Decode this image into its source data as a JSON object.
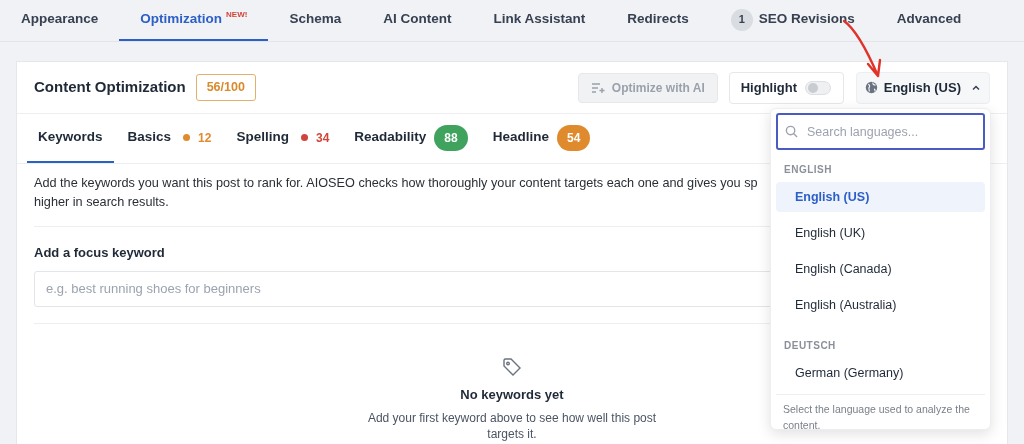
{
  "top_tabs": [
    {
      "label": "Appearance",
      "selected": false
    },
    {
      "label": "Optimization",
      "badge": "NEW!",
      "selected": true
    },
    {
      "label": "Schema",
      "selected": false
    },
    {
      "label": "AI Content",
      "selected": false
    },
    {
      "label": "Link Assistant",
      "selected": false
    },
    {
      "label": "Redirects",
      "selected": false
    },
    {
      "label": "SEO Revisions",
      "count": "1",
      "selected": false
    },
    {
      "label": "Advanced",
      "selected": false
    }
  ],
  "panel": {
    "title": "Content Optimization",
    "score": "56/100",
    "optimize_button": {
      "label": "Optimize with AI",
      "disabled": true
    },
    "highlight": {
      "label": "Highlight",
      "on": false
    },
    "language_button": {
      "label": "English (US)",
      "expanded": true
    }
  },
  "sub_tabs": [
    {
      "label": "Keywords",
      "selected": true
    },
    {
      "label": "Basics",
      "kind": "dot",
      "value": "12",
      "color": "#e08a2e",
      "selected": false
    },
    {
      "label": "Spelling",
      "kind": "dot",
      "value": "34",
      "color": "#d0443a",
      "selected": false
    },
    {
      "label": "Readability",
      "kind": "pill",
      "value": "88",
      "color": "#3fa35e",
      "selected": false
    },
    {
      "label": "Headline",
      "kind": "pill",
      "value": "54",
      "color": "#e08a2e",
      "selected": false
    }
  ],
  "description_lines": [
    "Add the keywords you want this post to rank for. AIOSEO checks how thoroughly your content targets each one and gives you sp",
    "higher in search results."
  ],
  "focus_keyword": {
    "label": "Add a focus keyword",
    "placeholder": "e.g. best running shoes for beginners"
  },
  "empty_state": {
    "title": "No keywords yet",
    "text": "Add your first keyword above to see how well this post targets it."
  },
  "language_menu": {
    "search_placeholder": "Search languages...",
    "groups": [
      {
        "heading": "ENGLISH",
        "items": [
          {
            "label": "English (US)",
            "selected": true
          },
          {
            "label": "English (UK)",
            "selected": false
          },
          {
            "label": "English (Canada)",
            "selected": false
          },
          {
            "label": "English (Australia)",
            "selected": false
          }
        ]
      },
      {
        "heading": "DEUTSCH",
        "items": [
          {
            "label": "German (Germany)",
            "selected": false
          }
        ]
      }
    ],
    "footer": "Select the language used to analyze the content."
  }
}
